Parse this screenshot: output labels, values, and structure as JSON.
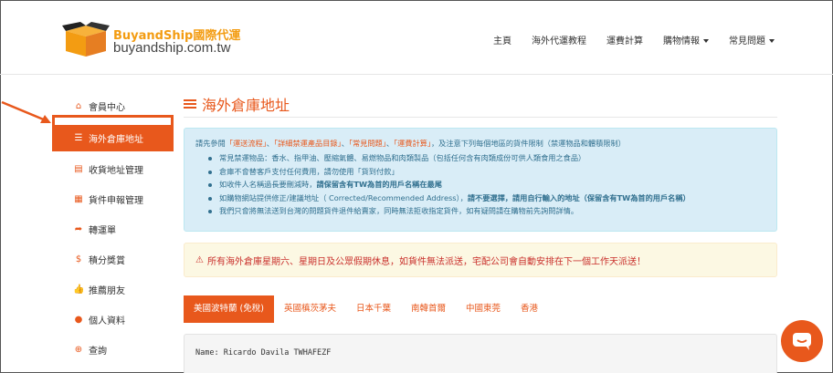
{
  "header": {
    "brand": "BuyandShip",
    "brand_cn": "國際代運",
    "url": "buyandship.com.tw",
    "nav": [
      {
        "label": "主頁",
        "dropdown": false
      },
      {
        "label": "海外代運教程",
        "dropdown": false
      },
      {
        "label": "運費計算",
        "dropdown": false
      },
      {
        "label": "購物情報",
        "dropdown": true
      },
      {
        "label": "常見問題",
        "dropdown": true
      }
    ]
  },
  "sidebar": {
    "items": [
      {
        "label": "會員中心",
        "icon": "home-icon"
      },
      {
        "label": "海外倉庫地址",
        "icon": "list-icon"
      },
      {
        "label": "收貨地址管理",
        "icon": "address-card-icon"
      },
      {
        "label": "貨件申報管理",
        "icon": "list-alt-icon"
      },
      {
        "label": "轉運單",
        "icon": "share-icon"
      },
      {
        "label": "積分獎賞",
        "icon": "dollar-icon"
      },
      {
        "label": "推薦朋友",
        "icon": "thumbs-up-icon"
      },
      {
        "label": "個人資料",
        "icon": "user-icon"
      },
      {
        "label": "查詢",
        "icon": "lifebuoy-icon"
      }
    ]
  },
  "main": {
    "title": "海外倉庫地址",
    "info": {
      "intro_pre": "請先參閱",
      "intro_links": [
        "「運送流程」",
        "「詳細禁運產品目錄」",
        "「常見問題」",
        "「運費計算」"
      ],
      "intro_sep": "、",
      "intro_post": "，及注意下列每個地區的貨件限制（禁運物品和體積限制）",
      "bullets": [
        {
          "pre": "常見禁運物品：香水、指甲油、壓縮氣體、易燃物品和肉類製品（包括任何含有肉類成份可供人類食用之食品）",
          "bold": "",
          "post": ""
        },
        {
          "pre": "倉庫不會替客戶支付任何費用，請勿使用「貨到付款」",
          "bold": "",
          "post": ""
        },
        {
          "pre": "如收件人名稱過長要刪減時，",
          "bold": "請保留含有TW為首的用戶名稱在最尾",
          "post": ""
        },
        {
          "pre": "如購物網站提供修正/建議地址（ Corrected/Recommended Address），",
          "bold": "請不要選擇，請用自行輸入的地址（保留含有TW為首的用戶名稱）",
          "post": ""
        },
        {
          "pre": "我們只會將無法送到台灣的問題貨件退件給賣家，同時無法拒收指定貨件，如有疑問請在購物前先詢問詳情。",
          "bold": "",
          "post": ""
        }
      ]
    },
    "warning": "所有海外倉庫星期六、星期日及公眾假期休息，如貨件無法派送，宅配公司會自動安排在下一個工作天派送！",
    "tabs": [
      "美國波特蘭 (免稅)",
      "英國槙茨茅夫",
      "日本千葉",
      "南韓首爾",
      "中國東莞",
      "香港"
    ],
    "address_line": "Name: Ricardo Davila TWHAFEZF"
  },
  "colors": {
    "accent": "#e8581c",
    "info_bg": "#d9edf7",
    "info_text": "#31708f",
    "warn_bg": "#fcf8e3",
    "warn_text": "#c9302c"
  }
}
